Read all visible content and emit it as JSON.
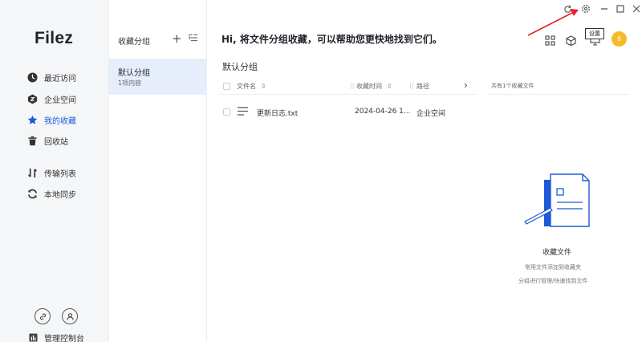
{
  "app": {
    "logo": "Filez"
  },
  "nav": {
    "items": [
      {
        "label": "最近访问",
        "icon": "clock-icon"
      },
      {
        "label": "企业空间",
        "icon": "enterprise-space-icon"
      },
      {
        "label": "我的收藏",
        "icon": "star-icon",
        "active": true
      },
      {
        "label": "回收站",
        "icon": "trash-icon"
      },
      {
        "label": "传输列表",
        "icon": "transfer-icon"
      },
      {
        "label": "本地同步",
        "icon": "sync-icon"
      }
    ],
    "admin_label": "管理控制台"
  },
  "groups": {
    "title": "收藏分组",
    "add_symbol": "+",
    "items": [
      {
        "name": "默认分组",
        "count": "1项内容"
      }
    ]
  },
  "main": {
    "headline": "Hi, 将文件分组收藏，可以帮助您更快地找到它们。",
    "subtitle": "默认分组",
    "columns": {
      "name": "文件名",
      "time": "收藏时间",
      "path": "路径"
    },
    "rows": [
      {
        "name": "更新日志.txt",
        "time": "2024-04-26 1...",
        "path": "企业空间"
      }
    ],
    "count_text": "共有1个收藏文件",
    "empty": {
      "title": "收藏文件",
      "desc_line1": "常用文件添加到收藏夹",
      "desc_line2": "分组进行管理/快速找到文件"
    }
  },
  "toolbar": {
    "tooltip": "设置",
    "avatar_text": "8"
  },
  "colors": {
    "accent": "#1e5ad8",
    "avatar": "#f7b925",
    "arrow": "#e8202a"
  }
}
